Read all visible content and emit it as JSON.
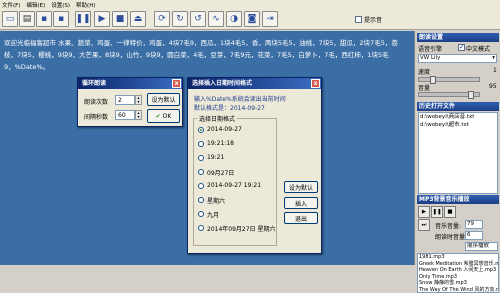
{
  "menu": [
    "文件(F)",
    "编辑(E)",
    "设置(S)",
    "帮助(H)"
  ],
  "toolbar": {
    "icons": [
      "new-file-icon",
      "open-folder-icon",
      "save-icon",
      "save-all-icon",
      "pause-icon",
      "play-icon",
      "stop-icon",
      "eject-icon",
      "loop-icon",
      "redo-icon",
      "refresh-icon",
      "wave-icon",
      "cycle-icon",
      "camera-icon",
      "exit-icon"
    ],
    "tip_label": "提示音",
    "tip_checked": false
  },
  "editor": {
    "text": "欢迎光临福客超市 水果、蔬菜、鸡蛋、一律特价，鸡蛋，4块7毛9，西瓜，1块4毛5，香，两块5毛5，油桃，7块5，甜瓜，2块7毛5，荔枝，7块5，樱桃，9块9，大芒果，8块9，山竹，9块9，圆白菜，4毛，豆芽，7毛9元，花菜，7毛5，白萝卜，7毛，西红柿，1块5毛9，%Date%。"
  },
  "right_panel": {
    "read_header": "朗读设置",
    "voice_label": "语音引擎",
    "chinese_mode_label": "中文模式",
    "chinese_mode_checked": true,
    "voice_value": "VW Lily",
    "speed_label": "速度",
    "speed_value": "1",
    "speed_level": 0.2,
    "volume_label": "音量",
    "volume_value": "95",
    "volume_level": 0.9,
    "history_header": "历史打开文件",
    "history_items": [
      "d:\\wobeyi\\商店音.txt",
      "d:\\wobeyi\\超市.txt"
    ],
    "mp3_header": "MP3背景音乐播放",
    "music_volume_label": "音乐音量:",
    "music_volume_value": "79",
    "read_volume_label": "朗读时音量:",
    "read_volume_value": "6",
    "play_order_value": "顺序播放",
    "playlist": [
      "1981.mp3",
      "Greek Meditation 希腊冥想音乐.mp3",
      "Heaven On Earth 人间天上.mp3",
      "Only Time.mp3",
      "Snow 静静的雪.mp3",
      "The Way Of The Wind 风的方向.mp3"
    ]
  },
  "loop_dialog": {
    "title": "循环朗读",
    "count_label": "朗读次数",
    "count_value": "2",
    "interval_label": "间隔秒数",
    "interval_value": "60",
    "set_default_label": "设为默认",
    "ok_label": "OK",
    "close_glyph": "x"
  },
  "date_dialog": {
    "title": "选择插入日期时间格式",
    "desc1": "输入%Date%系统会读出当前时间",
    "desc2": "默认格式是：2014-09-27",
    "group_caption": "选择日期格式",
    "options": [
      "2014-09-27",
      "19:21:18",
      "19:21",
      "09月27日",
      "2014-09-27 19:21",
      "星期六",
      "九月",
      "2014年09月27日 星期六"
    ],
    "selected_index": 0,
    "set_default_label": "设为默认",
    "insert_label": "插入",
    "exit_label": "退出",
    "close_glyph": "x"
  }
}
